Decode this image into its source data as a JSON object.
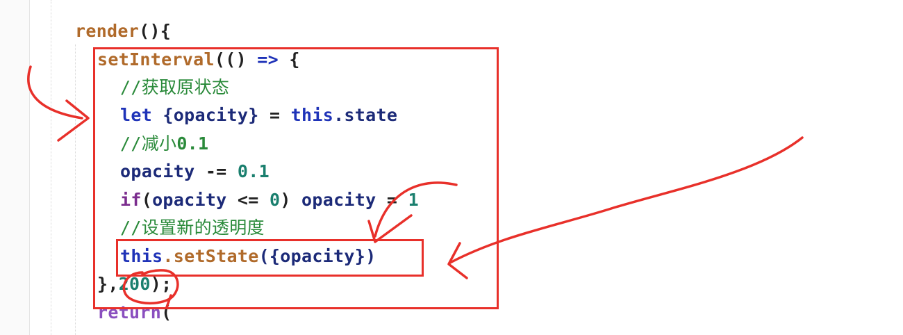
{
  "editor": {
    "lines": {
      "render": {
        "name": "render",
        "parens": "(){"
      },
      "set_interval": {
        "fn": "setInterval",
        "open": "((",
        "paren_close": ")",
        "arrow": "=>",
        "brace": "{"
      },
      "comment_get_state": "//获取原状态",
      "let_line": {
        "kw": "let",
        "destructure": "{opacity}",
        "eq": "=",
        "this_kw": "this",
        "prop": ".state"
      },
      "comment_decrease": {
        "prefix": "//减小",
        "num": "0.1"
      },
      "decrement_line": {
        "var": "opacity",
        "op": "-=",
        "num": "0.1"
      },
      "if_line": {
        "kw": "if",
        "open": "(",
        "var1": "opacity",
        "op": "<=",
        "zero": "0",
        "close": ")",
        "var2": "opacity",
        "eq": "=",
        "one": "1"
      },
      "comment_set_opacity": "//设置新的透明度",
      "set_state_line": {
        "this_kw": "this",
        "method": ".setState",
        "arg": "({opacity})"
      },
      "close_line": {
        "brace": "},",
        "delay": "200",
        "end": ");"
      },
      "return_line": {
        "kw": "return",
        "open": "("
      }
    }
  },
  "annotations": {
    "color": "#e8302a"
  }
}
